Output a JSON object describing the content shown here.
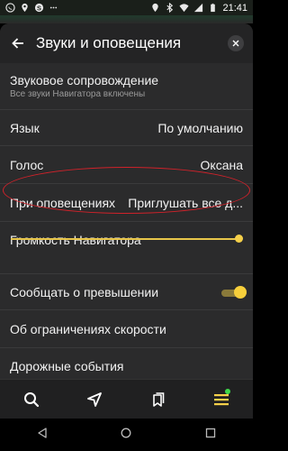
{
  "status_bar": {
    "time": "21:41",
    "left_icons": [
      "whatsapp-icon",
      "location-pin-icon",
      "skype-icon",
      "dots-icon"
    ],
    "right_icons": [
      "location-icon",
      "bluetooth-icon",
      "wifi-icon",
      "signal-icon",
      "battery-icon"
    ]
  },
  "header": {
    "title": "Звуки и оповещения",
    "back_icon": "arrow-left-icon",
    "close_icon": "close-icon"
  },
  "settings": {
    "sound": {
      "label": "Звуковое сопровождение",
      "subtitle": "Все звуки Навигатора включены"
    },
    "language": {
      "label": "Язык",
      "value": "По умолчанию"
    },
    "voice": {
      "label": "Голос",
      "value": "Оксана"
    },
    "notifications": {
      "label": "При оповещениях",
      "value": "Приглушать все д..."
    },
    "volume": {
      "label": "Громкость Навигатора",
      "level": 1.0
    },
    "speeding": {
      "label": "Сообщать о превышении",
      "enabled": true
    },
    "speed_limits": {
      "label": "Об ограничениях скорости"
    },
    "road_events": {
      "label": "Дорожные события"
    }
  },
  "colors": {
    "accent": "#f5d04a",
    "highlight_oval": "#d0222a",
    "background": "#2b2b2c"
  },
  "tabbar": {
    "items": [
      "search-icon",
      "navigation-arrow-icon",
      "bookmarks-icon",
      "menu-icon"
    ]
  },
  "navbar": {
    "items": [
      "back-triangle-icon",
      "home-circle-icon",
      "recents-square-icon"
    ]
  }
}
